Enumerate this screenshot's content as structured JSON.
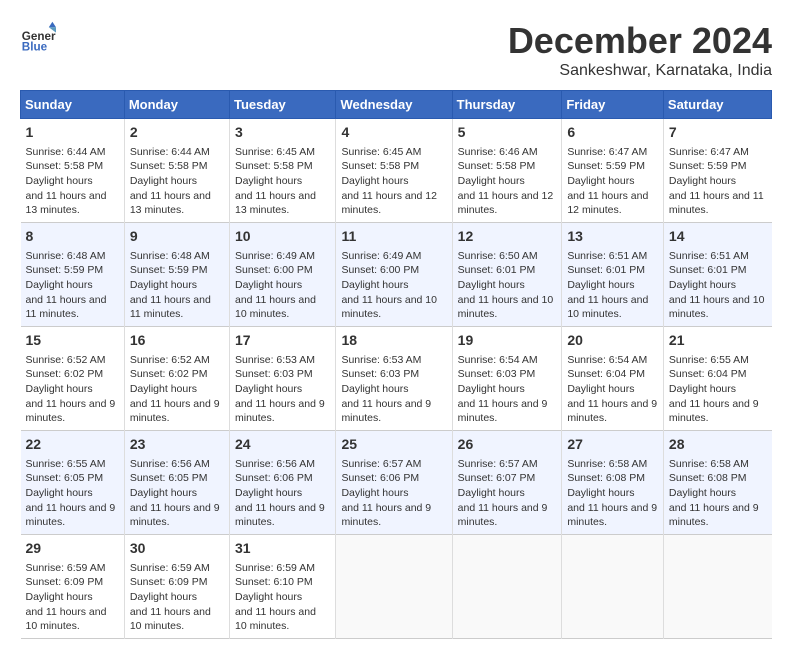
{
  "logo": {
    "line1": "General",
    "line2": "Blue"
  },
  "title": "December 2024",
  "location": "Sankeshwar, Karnataka, India",
  "days_of_week": [
    "Sunday",
    "Monday",
    "Tuesday",
    "Wednesday",
    "Thursday",
    "Friday",
    "Saturday"
  ],
  "weeks": [
    [
      {
        "day": 1,
        "sunrise": "6:44 AM",
        "sunset": "5:58 PM",
        "daylight": "11 hours and 13 minutes."
      },
      {
        "day": 2,
        "sunrise": "6:44 AM",
        "sunset": "5:58 PM",
        "daylight": "11 hours and 13 minutes."
      },
      {
        "day": 3,
        "sunrise": "6:45 AM",
        "sunset": "5:58 PM",
        "daylight": "11 hours and 13 minutes."
      },
      {
        "day": 4,
        "sunrise": "6:45 AM",
        "sunset": "5:58 PM",
        "daylight": "11 hours and 12 minutes."
      },
      {
        "day": 5,
        "sunrise": "6:46 AM",
        "sunset": "5:58 PM",
        "daylight": "11 hours and 12 minutes."
      },
      {
        "day": 6,
        "sunrise": "6:47 AM",
        "sunset": "5:59 PM",
        "daylight": "11 hours and 12 minutes."
      },
      {
        "day": 7,
        "sunrise": "6:47 AM",
        "sunset": "5:59 PM",
        "daylight": "11 hours and 11 minutes."
      }
    ],
    [
      {
        "day": 8,
        "sunrise": "6:48 AM",
        "sunset": "5:59 PM",
        "daylight": "11 hours and 11 minutes."
      },
      {
        "day": 9,
        "sunrise": "6:48 AM",
        "sunset": "5:59 PM",
        "daylight": "11 hours and 11 minutes."
      },
      {
        "day": 10,
        "sunrise": "6:49 AM",
        "sunset": "6:00 PM",
        "daylight": "11 hours and 10 minutes."
      },
      {
        "day": 11,
        "sunrise": "6:49 AM",
        "sunset": "6:00 PM",
        "daylight": "11 hours and 10 minutes."
      },
      {
        "day": 12,
        "sunrise": "6:50 AM",
        "sunset": "6:01 PM",
        "daylight": "11 hours and 10 minutes."
      },
      {
        "day": 13,
        "sunrise": "6:51 AM",
        "sunset": "6:01 PM",
        "daylight": "11 hours and 10 minutes."
      },
      {
        "day": 14,
        "sunrise": "6:51 AM",
        "sunset": "6:01 PM",
        "daylight": "11 hours and 10 minutes."
      }
    ],
    [
      {
        "day": 15,
        "sunrise": "6:52 AM",
        "sunset": "6:02 PM",
        "daylight": "11 hours and 9 minutes."
      },
      {
        "day": 16,
        "sunrise": "6:52 AM",
        "sunset": "6:02 PM",
        "daylight": "11 hours and 9 minutes."
      },
      {
        "day": 17,
        "sunrise": "6:53 AM",
        "sunset": "6:03 PM",
        "daylight": "11 hours and 9 minutes."
      },
      {
        "day": 18,
        "sunrise": "6:53 AM",
        "sunset": "6:03 PM",
        "daylight": "11 hours and 9 minutes."
      },
      {
        "day": 19,
        "sunrise": "6:54 AM",
        "sunset": "6:03 PM",
        "daylight": "11 hours and 9 minutes."
      },
      {
        "day": 20,
        "sunrise": "6:54 AM",
        "sunset": "6:04 PM",
        "daylight": "11 hours and 9 minutes."
      },
      {
        "day": 21,
        "sunrise": "6:55 AM",
        "sunset": "6:04 PM",
        "daylight": "11 hours and 9 minutes."
      }
    ],
    [
      {
        "day": 22,
        "sunrise": "6:55 AM",
        "sunset": "6:05 PM",
        "daylight": "11 hours and 9 minutes."
      },
      {
        "day": 23,
        "sunrise": "6:56 AM",
        "sunset": "6:05 PM",
        "daylight": "11 hours and 9 minutes."
      },
      {
        "day": 24,
        "sunrise": "6:56 AM",
        "sunset": "6:06 PM",
        "daylight": "11 hours and 9 minutes."
      },
      {
        "day": 25,
        "sunrise": "6:57 AM",
        "sunset": "6:06 PM",
        "daylight": "11 hours and 9 minutes."
      },
      {
        "day": 26,
        "sunrise": "6:57 AM",
        "sunset": "6:07 PM",
        "daylight": "11 hours and 9 minutes."
      },
      {
        "day": 27,
        "sunrise": "6:58 AM",
        "sunset": "6:08 PM",
        "daylight": "11 hours and 9 minutes."
      },
      {
        "day": 28,
        "sunrise": "6:58 AM",
        "sunset": "6:08 PM",
        "daylight": "11 hours and 9 minutes."
      }
    ],
    [
      {
        "day": 29,
        "sunrise": "6:59 AM",
        "sunset": "6:09 PM",
        "daylight": "11 hours and 10 minutes."
      },
      {
        "day": 30,
        "sunrise": "6:59 AM",
        "sunset": "6:09 PM",
        "daylight": "11 hours and 10 minutes."
      },
      {
        "day": 31,
        "sunrise": "6:59 AM",
        "sunset": "6:10 PM",
        "daylight": "11 hours and 10 minutes."
      },
      null,
      null,
      null,
      null
    ]
  ]
}
